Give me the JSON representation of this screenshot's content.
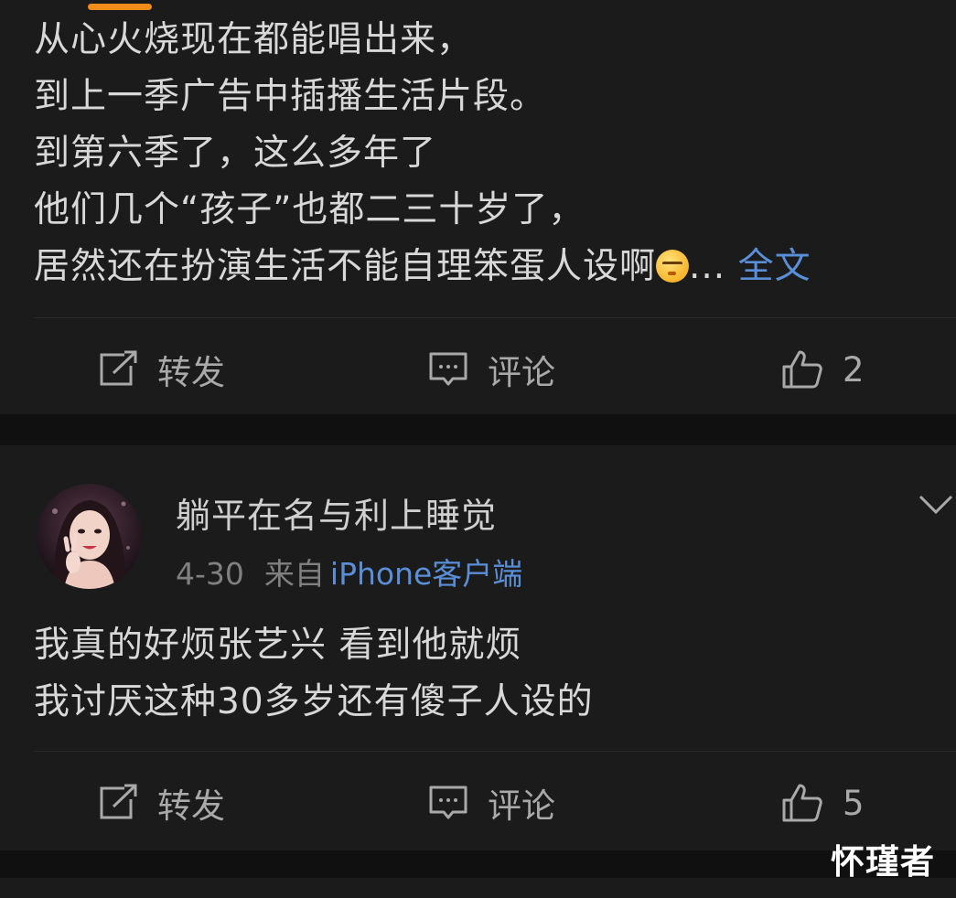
{
  "post1": {
    "lines": [
      "从心火烧现在都能唱出来，",
      "到上一季广告中插播生活片段。",
      "到第六季了，这么多年了",
      "他们几个“孩子”也都二三十岁了，"
    ],
    "last_line": "居然还在扮演生活不能自理笨蛋人设啊",
    "ellipsis": "...",
    "full_text_link": "全文",
    "emoji_icon": "squinting-face-emoji",
    "actions": {
      "repost": "转发",
      "comment": "评论",
      "likes": "2"
    }
  },
  "post2": {
    "username": "躺平在名与利上睡觉",
    "date": "4-30",
    "source_prefix": "来自",
    "client": "iPhone客户端",
    "lines": [
      "我真的好烦张艺兴 看到他就烦",
      "我讨厌这种30多岁还有傻子人设的"
    ],
    "actions": {
      "repost": "转发",
      "comment": "评论",
      "likes": "5"
    }
  },
  "watermark": "怀瑾者",
  "colors": {
    "background": "#101010",
    "card": "#1b1b1b",
    "text": "#d8d8d8",
    "link": "#5a8fd8",
    "tab_indicator": "#f28c1b"
  }
}
